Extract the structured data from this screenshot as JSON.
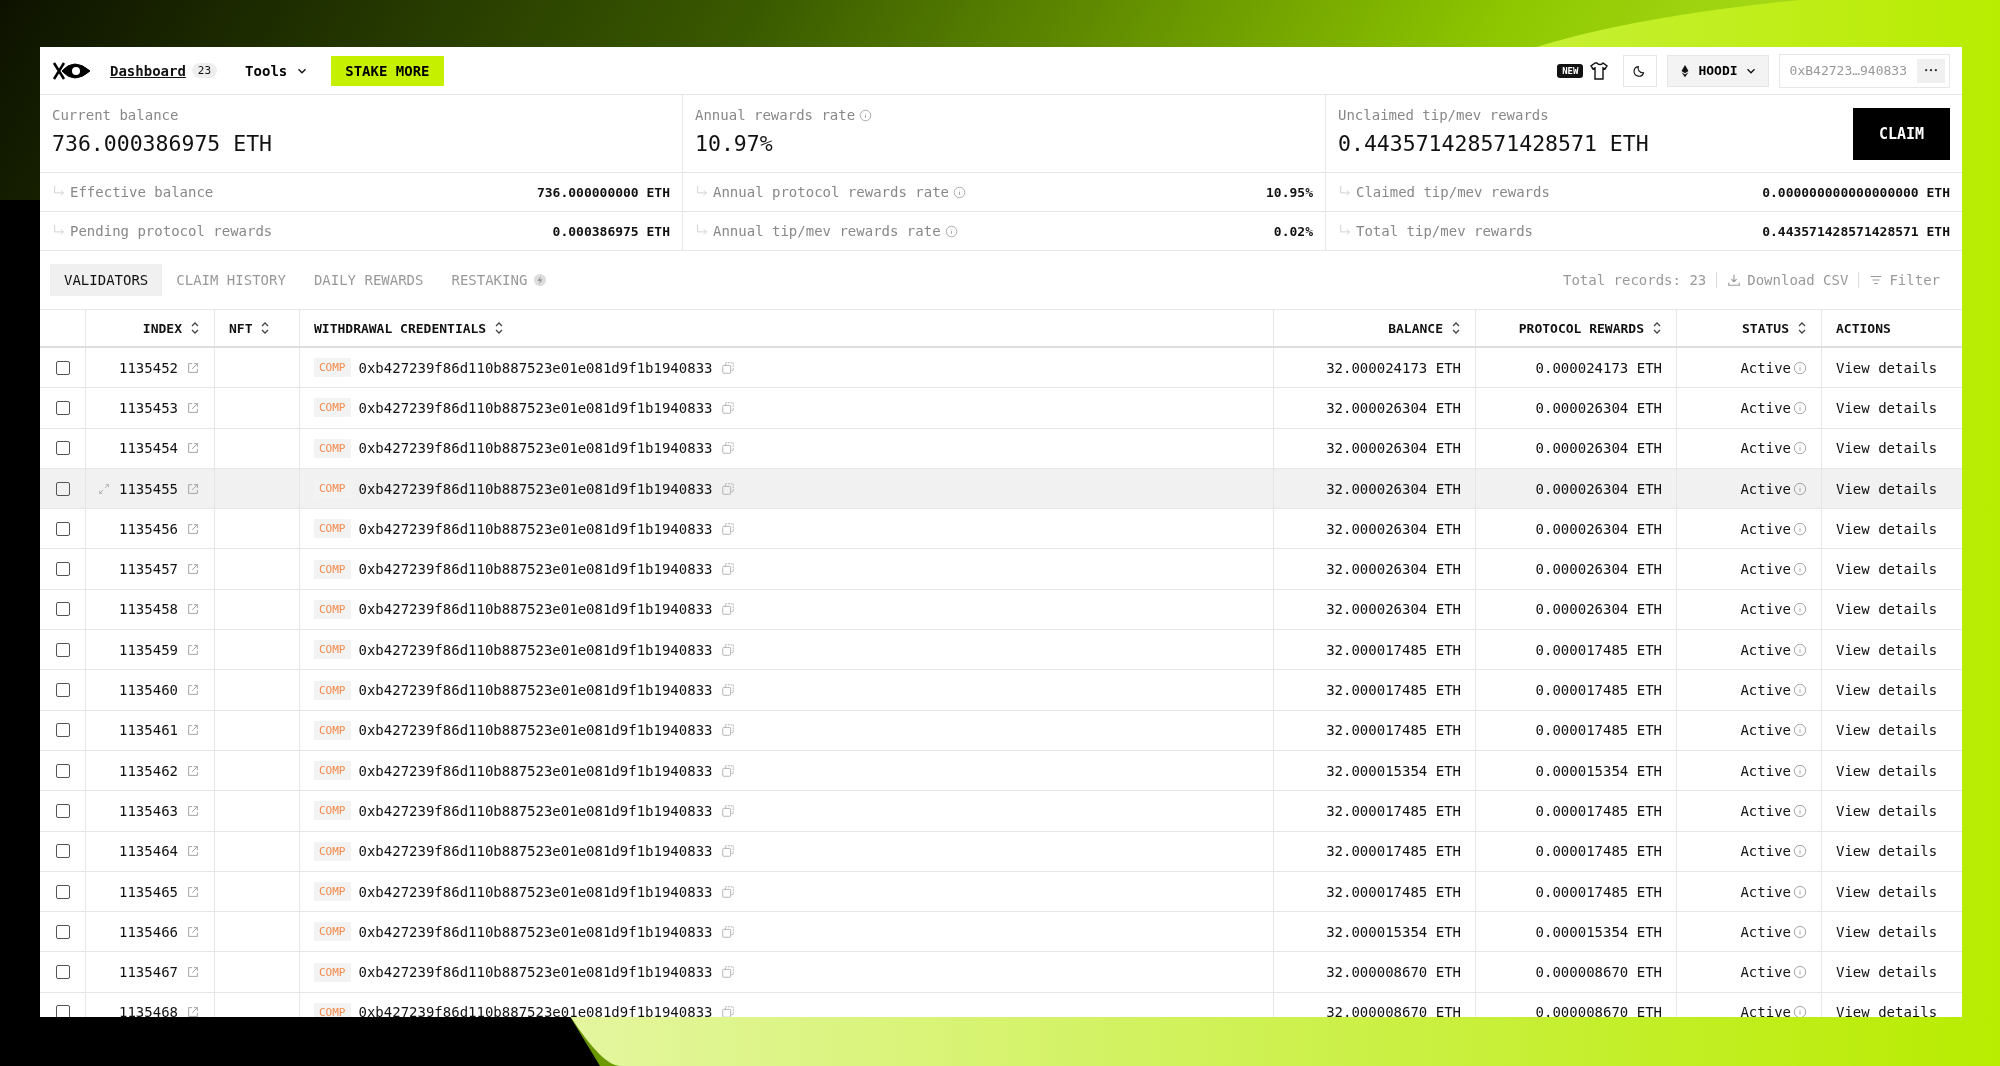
{
  "nav": {
    "dashboard": "Dashboard",
    "dashboard_count": "23",
    "tools": "Tools",
    "stake_button": "STAKE MORE",
    "new_badge": "NEW",
    "network": "HOODI",
    "address": "0xB42723…940833"
  },
  "stats": [
    {
      "label": "Current balance",
      "info": false,
      "value": "736.000386975 ETH",
      "details": [
        {
          "label": "Effective balance",
          "info": false,
          "value": "736.000000000 ETH"
        },
        {
          "label": "Pending protocol rewards",
          "info": false,
          "value": "0.000386975 ETH"
        }
      ]
    },
    {
      "label": "Annual rewards rate",
      "info": true,
      "value": "10.97%",
      "details": [
        {
          "label": "Annual protocol rewards rate",
          "info": true,
          "value": "10.95%"
        },
        {
          "label": "Annual tip/mev rewards rate",
          "info": true,
          "value": "0.02%"
        }
      ]
    },
    {
      "label": "Unclaimed tip/mev rewards",
      "info": false,
      "value": "0.443571428571428571 ETH",
      "details": [
        {
          "label": "Claimed tip/mev rewards",
          "info": false,
          "value": "0.000000000000000000 ETH"
        },
        {
          "label": "Total tip/mev rewards",
          "info": false,
          "value": "0.443571428571428571 ETH"
        }
      ]
    }
  ],
  "claim_button": "CLAIM",
  "tabs": [
    {
      "label": "VALIDATORS",
      "selected": true,
      "flagged": false
    },
    {
      "label": "CLAIM HISTORY",
      "selected": false,
      "flagged": false
    },
    {
      "label": "DAILY REWARDS",
      "selected": false,
      "flagged": false
    },
    {
      "label": "RESTAKING",
      "selected": false,
      "flagged": true
    }
  ],
  "toolbar": {
    "total_records": "Total records: 23",
    "download": "Download CSV",
    "filter": "Filter"
  },
  "table": {
    "columns": [
      {
        "label": "INDEX",
        "sortable": true
      },
      {
        "label": "NFT",
        "sortable": true
      },
      {
        "label": "WITHDRAWAL CREDENTIALS",
        "sortable": true
      },
      {
        "label": "BALANCE",
        "sortable": true
      },
      {
        "label": "PROTOCOL REWARDS",
        "sortable": true
      },
      {
        "label": "STATUS",
        "sortable": true
      },
      {
        "label": "ACTIONS",
        "sortable": false
      }
    ],
    "rows": [
      {
        "checked": false,
        "highlighted": false,
        "index": "1135452",
        "type": "COMP",
        "credentials": "0xb427239f86d110b887523e01e081d9f1b1940833",
        "balance": "32.000024173 ETH",
        "protocol_rewards": "0.000024173 ETH",
        "status": "Active",
        "action": "View details"
      },
      {
        "checked": false,
        "highlighted": false,
        "index": "1135453",
        "type": "COMP",
        "credentials": "0xb427239f86d110b887523e01e081d9f1b1940833",
        "balance": "32.000026304 ETH",
        "protocol_rewards": "0.000026304 ETH",
        "status": "Active",
        "action": "View details"
      },
      {
        "checked": false,
        "highlighted": false,
        "index": "1135454",
        "type": "COMP",
        "credentials": "0xb427239f86d110b887523e01e081d9f1b1940833",
        "balance": "32.000026304 ETH",
        "protocol_rewards": "0.000026304 ETH",
        "status": "Active",
        "action": "View details"
      },
      {
        "checked": false,
        "highlighted": true,
        "index": "1135455",
        "type": "COMP",
        "credentials": "0xb427239f86d110b887523e01e081d9f1b1940833",
        "balance": "32.000026304 ETH",
        "protocol_rewards": "0.000026304 ETH",
        "status": "Active",
        "action": "View details"
      },
      {
        "checked": false,
        "highlighted": false,
        "index": "1135456",
        "type": "COMP",
        "credentials": "0xb427239f86d110b887523e01e081d9f1b1940833",
        "balance": "32.000026304 ETH",
        "protocol_rewards": "0.000026304 ETH",
        "status": "Active",
        "action": "View details"
      },
      {
        "checked": false,
        "highlighted": false,
        "index": "1135457",
        "type": "COMP",
        "credentials": "0xb427239f86d110b887523e01e081d9f1b1940833",
        "balance": "32.000026304 ETH",
        "protocol_rewards": "0.000026304 ETH",
        "status": "Active",
        "action": "View details"
      },
      {
        "checked": false,
        "highlighted": false,
        "index": "1135458",
        "type": "COMP",
        "credentials": "0xb427239f86d110b887523e01e081d9f1b1940833",
        "balance": "32.000026304 ETH",
        "protocol_rewards": "0.000026304 ETH",
        "status": "Active",
        "action": "View details"
      },
      {
        "checked": false,
        "highlighted": false,
        "index": "1135459",
        "type": "COMP",
        "credentials": "0xb427239f86d110b887523e01e081d9f1b1940833",
        "balance": "32.000017485 ETH",
        "protocol_rewards": "0.000017485 ETH",
        "status": "Active",
        "action": "View details"
      },
      {
        "checked": false,
        "highlighted": false,
        "index": "1135460",
        "type": "COMP",
        "credentials": "0xb427239f86d110b887523e01e081d9f1b1940833",
        "balance": "32.000017485 ETH",
        "protocol_rewards": "0.000017485 ETH",
        "status": "Active",
        "action": "View details"
      },
      {
        "checked": false,
        "highlighted": false,
        "index": "1135461",
        "type": "COMP",
        "credentials": "0xb427239f86d110b887523e01e081d9f1b1940833",
        "balance": "32.000017485 ETH",
        "protocol_rewards": "0.000017485 ETH",
        "status": "Active",
        "action": "View details"
      },
      {
        "checked": false,
        "highlighted": false,
        "index": "1135462",
        "type": "COMP",
        "credentials": "0xb427239f86d110b887523e01e081d9f1b1940833",
        "balance": "32.000015354 ETH",
        "protocol_rewards": "0.000015354 ETH",
        "status": "Active",
        "action": "View details"
      },
      {
        "checked": false,
        "highlighted": false,
        "index": "1135463",
        "type": "COMP",
        "credentials": "0xb427239f86d110b887523e01e081d9f1b1940833",
        "balance": "32.000017485 ETH",
        "protocol_rewards": "0.000017485 ETH",
        "status": "Active",
        "action": "View details"
      },
      {
        "checked": false,
        "highlighted": false,
        "index": "1135464",
        "type": "COMP",
        "credentials": "0xb427239f86d110b887523e01e081d9f1b1940833",
        "balance": "32.000017485 ETH",
        "protocol_rewards": "0.000017485 ETH",
        "status": "Active",
        "action": "View details"
      },
      {
        "checked": false,
        "highlighted": false,
        "index": "1135465",
        "type": "COMP",
        "credentials": "0xb427239f86d110b887523e01e081d9f1b1940833",
        "balance": "32.000017485 ETH",
        "protocol_rewards": "0.000017485 ETH",
        "status": "Active",
        "action": "View details"
      },
      {
        "checked": false,
        "highlighted": false,
        "index": "1135466",
        "type": "COMP",
        "credentials": "0xb427239f86d110b887523e01e081d9f1b1940833",
        "balance": "32.000015354 ETH",
        "protocol_rewards": "0.000015354 ETH",
        "status": "Active",
        "action": "View details"
      },
      {
        "checked": false,
        "highlighted": false,
        "index": "1135467",
        "type": "COMP",
        "credentials": "0xb427239f86d110b887523e01e081d9f1b1940833",
        "balance": "32.000008670 ETH",
        "protocol_rewards": "0.000008670 ETH",
        "status": "Active",
        "action": "View details"
      },
      {
        "checked": false,
        "highlighted": false,
        "index": "1135468",
        "type": "COMP",
        "credentials": "0xb427239f86d110b887523e01e081d9f1b1940833",
        "balance": "32.000008670 ETH",
        "protocol_rewards": "0.000008670 ETH",
        "status": "Active",
        "action": "View details"
      }
    ]
  }
}
